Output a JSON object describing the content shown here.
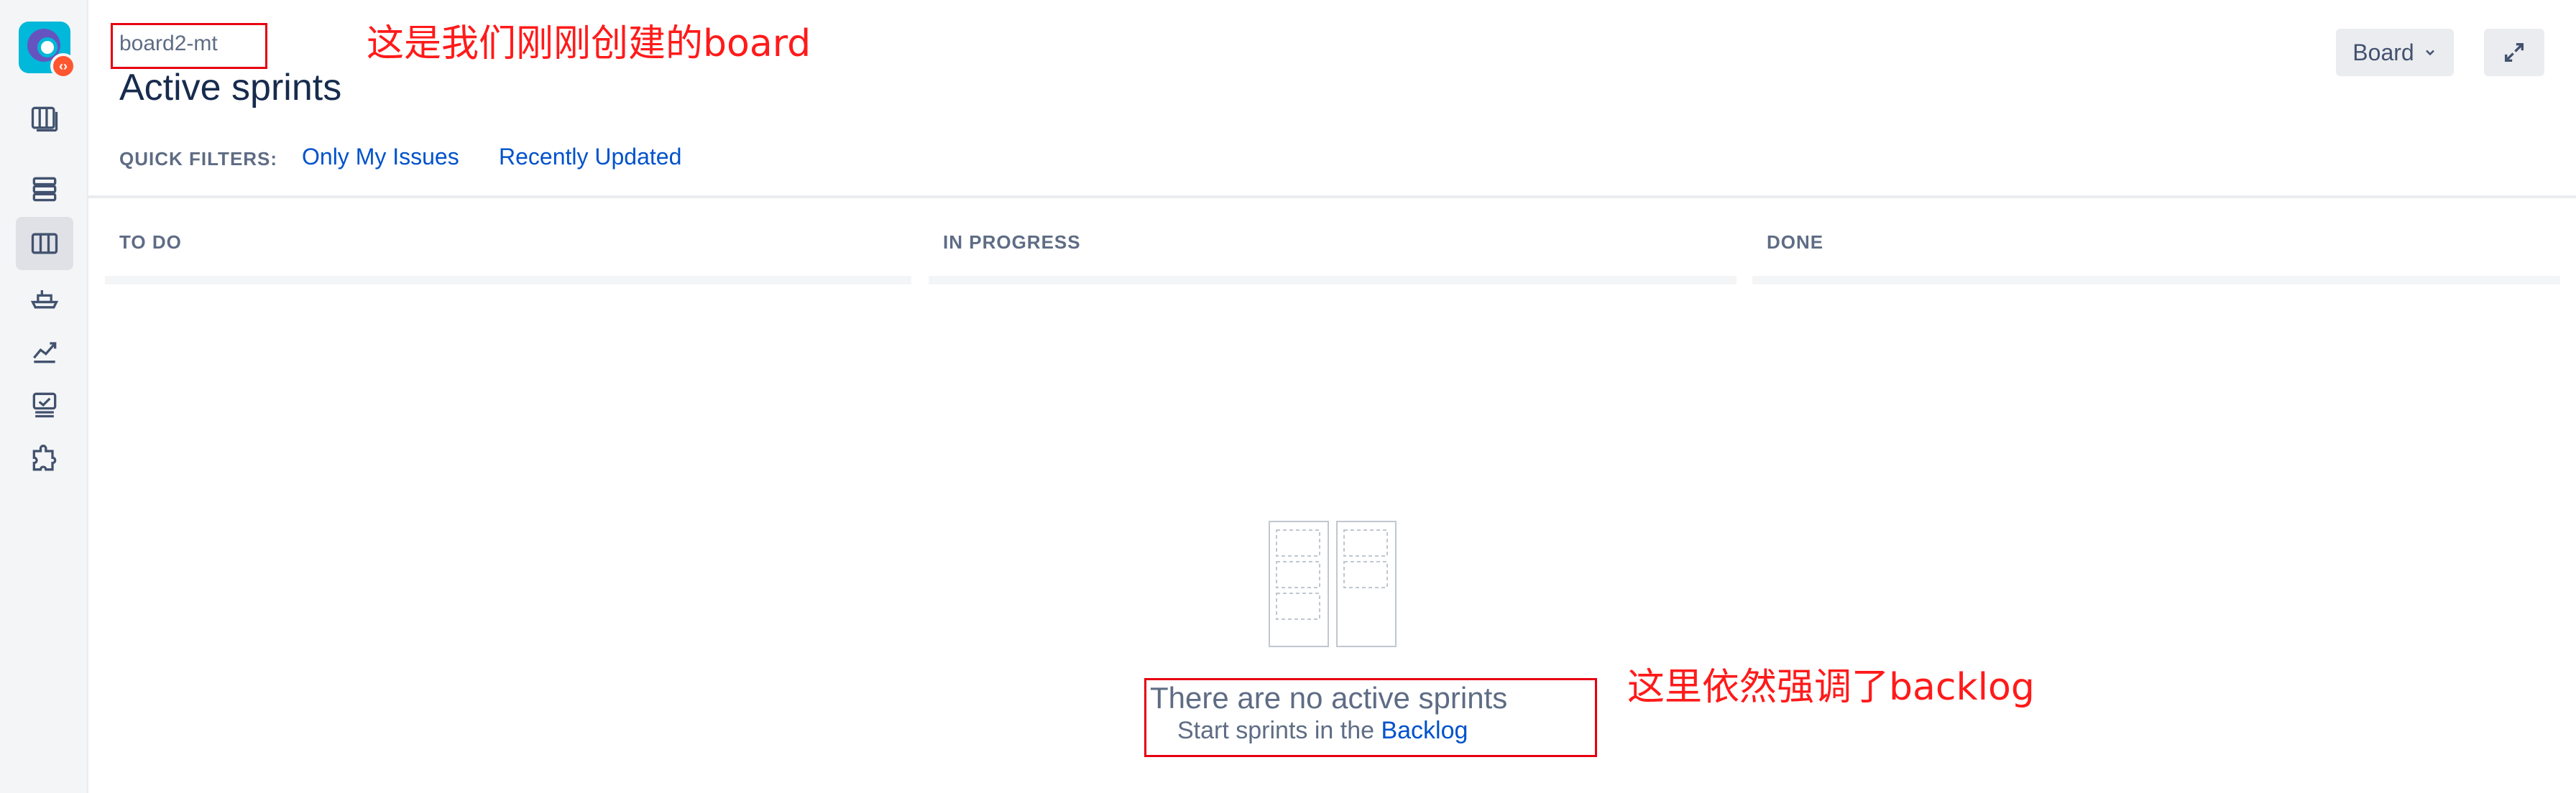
{
  "sidebar": {
    "logo_badge": "‹›",
    "items": [
      {
        "name": "board-icon"
      },
      {
        "name": "backlog-icon"
      },
      {
        "name": "active-sprints-icon",
        "selected": true
      },
      {
        "name": "releases-icon"
      },
      {
        "name": "reports-icon"
      },
      {
        "name": "issues-icon"
      },
      {
        "name": "addons-icon"
      }
    ]
  },
  "header": {
    "breadcrumb": "board2-mt",
    "title": "Active sprints",
    "board_button": "Board",
    "expand_icon": "expand-icon"
  },
  "annotations": {
    "top": "这是我们刚刚创建的board",
    "bottom": "这里依然强调了backlog",
    "color": "#FF1A1A"
  },
  "quick_filters": {
    "label": "QUICK FILTERS:",
    "items": [
      "Only My Issues",
      "Recently Updated"
    ]
  },
  "columns": [
    "TO DO",
    "IN PROGRESS",
    "DONE"
  ],
  "empty_state": {
    "title": "There are no active sprints",
    "subtitle_prefix": "Start sprints in the",
    "link": "Backlog"
  },
  "colors": {
    "link": "#0052CC",
    "text_primary": "#172B4D",
    "text_secondary": "#5E6C84",
    "sidebar_bg": "#F4F5F7"
  }
}
